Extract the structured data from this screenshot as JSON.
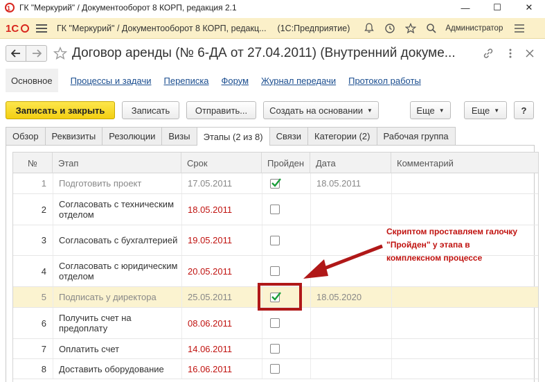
{
  "window": {
    "title": "ГК \"Меркурий\" / Документооборот 8 КОРП, редакция 2.1",
    "minimize": "—",
    "maximize": "☐",
    "close": "✕"
  },
  "app_toolbar": {
    "logo": "1С",
    "title": "ГК \"Меркурий\" / Документооборот 8 КОРП, редакц...",
    "mode": "(1С:Предприятие)",
    "user": "Администратор",
    "icons": [
      "bell-icon",
      "history-icon",
      "star-icon",
      "search-icon",
      "menu-icon"
    ]
  },
  "form": {
    "title": "Договор аренды (№ 6-ДА от 27.04.2011) (Внутренний докуме...",
    "icons": [
      "link-icon",
      "more-icon",
      "close-icon"
    ]
  },
  "panel": {
    "active": "Основное",
    "links": [
      "Процессы и задачи",
      "Переписка",
      "Форум",
      "Журнал передачи",
      "Протокол работы"
    ]
  },
  "commands": {
    "save_close": "Записать и закрыть",
    "save": "Записать",
    "send": "Отправить...",
    "create_based": "Создать на основании",
    "more1": "Еще",
    "more2": "Еще",
    "help": "?"
  },
  "tabs": [
    "Обзор",
    "Реквизиты",
    "Резолюции",
    "Визы",
    "Этапы (2 из 8)",
    "Связи",
    "Категории (2)",
    "Рабочая группа"
  ],
  "selected_tab": "Этапы (2 из 8)",
  "table": {
    "headers": [
      "№",
      "Этап",
      "Срок",
      "Пройден",
      "Дата",
      "Комментарий"
    ],
    "rows": [
      {
        "n": "1",
        "stage": "Подготовить проект",
        "due": "17.05.2011",
        "done": true,
        "date": "18.05.2011",
        "style": "dim"
      },
      {
        "n": "2",
        "stage": "Согласовать с техническим отделом",
        "due": "18.05.2011",
        "done": false,
        "date": "",
        "style": "red"
      },
      {
        "n": "3",
        "stage": "Согласовать с бухгалтерией",
        "due": "19.05.2011",
        "done": false,
        "date": "",
        "style": "red"
      },
      {
        "n": "4",
        "stage": "Согласовать с юридическим отделом",
        "due": "20.05.2011",
        "done": false,
        "date": "",
        "style": "red"
      },
      {
        "n": "5",
        "stage": "Подписать у директора",
        "due": "25.05.2011",
        "done": true,
        "date": "18.05.2020",
        "style": "highlight"
      },
      {
        "n": "6",
        "stage": "Получить счет на предоплату",
        "due": "08.06.2011",
        "done": false,
        "date": "",
        "style": "red"
      },
      {
        "n": "7",
        "stage": "Оплатить счет",
        "due": "14.06.2011",
        "done": false,
        "date": "",
        "style": "red"
      },
      {
        "n": "8",
        "stage": "Доставить оборудование",
        "due": "16.06.2011",
        "done": false,
        "date": "",
        "style": "red"
      }
    ]
  },
  "annotation": {
    "lines": [
      "Скриптом проставляем галочку",
      "\"Пройден\" у этапа в",
      "комплексном процессе"
    ]
  },
  "colors": {
    "accent_yellow": "#f3cf12",
    "toolbar_bg": "#fbf0c9",
    "overdue_red": "#c0120f",
    "link_blue": "#1a4d8f",
    "check_green": "#1a9e3a"
  }
}
